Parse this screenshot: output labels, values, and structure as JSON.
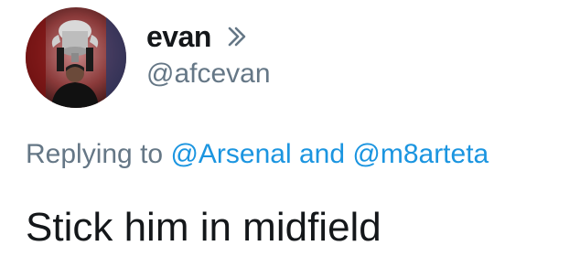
{
  "user": {
    "display_name": "evan",
    "handle": "@afcevan"
  },
  "reply": {
    "prefix": "Replying to",
    "mention_1": "@Arsenal",
    "conjunction": "and",
    "mention_2": "@m8arteta"
  },
  "tweet": {
    "text": "Stick him in midfield"
  },
  "icons": {
    "more": "chevron-right-double-icon"
  },
  "colors": {
    "link": "#1b95e0",
    "secondary_text": "#657786",
    "primary_text": "#14171a"
  }
}
